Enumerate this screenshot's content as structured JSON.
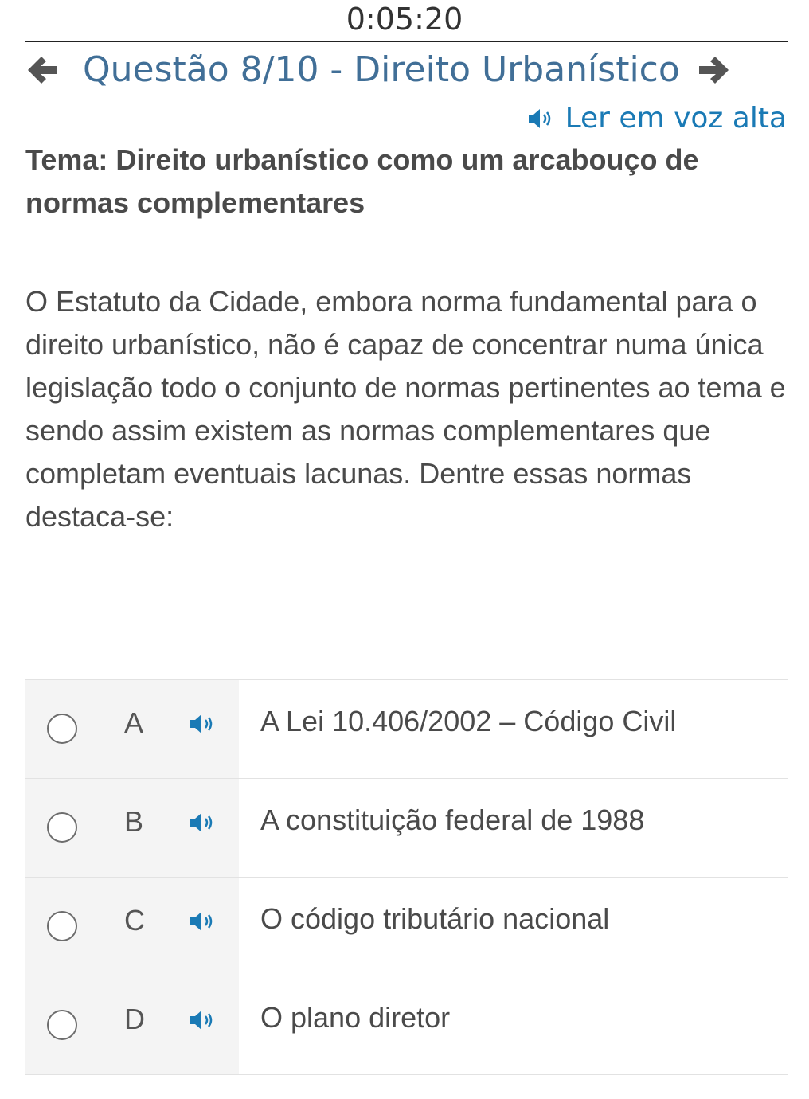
{
  "timer": "0:05:20",
  "header": {
    "title": "Questão 8/10 - Direito Urbanístico",
    "prev_icon": "arrow-left-icon",
    "next_icon": "arrow-right-icon"
  },
  "read_aloud": {
    "label": "Ler em voz alta",
    "icon": "speaker-icon"
  },
  "topic": "Tema: Direito urbanístico como um arcabouço de normas complementares",
  "question": "O Estatuto da Cidade, embora norma fundamental para o direito urbanístico, não é capaz de concentrar numa única legislação todo o conjunto de normas pertinentes ao tema e sendo assim existem as normas complementares que completam eventuais lacunas. Dentre essas normas destaca-se:",
  "options": [
    {
      "letter": "A",
      "text": "A Lei 10.406/2002 – Código Civil"
    },
    {
      "letter": "B",
      "text": "A constituição federal de 1988"
    },
    {
      "letter": "C",
      "text": "O código tributário nacional"
    },
    {
      "letter": "D",
      "text": "O plano diretor"
    }
  ],
  "colors": {
    "title": "#416f97",
    "accent": "#1a7ab5",
    "arrow": "#555555"
  }
}
